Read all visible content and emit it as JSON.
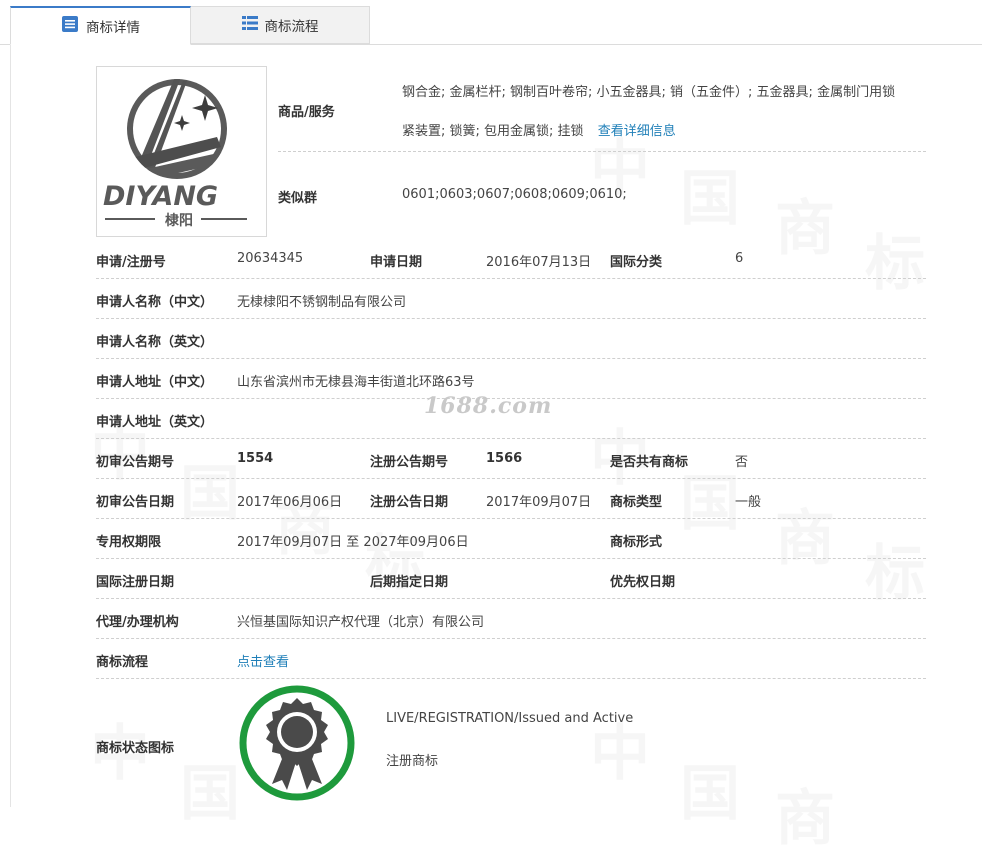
{
  "tabs": {
    "details": "商标详情",
    "flow": "商标流程"
  },
  "logo": {
    "main_text": "DIYANG",
    "sub_text": "棣阳"
  },
  "goods": {
    "label": "商品/服务",
    "line1": "钢合金; 金属栏杆; 钢制百叶卷帘; 小五金器具; 销（五金件）; 五金器具; 金属制门用锁",
    "line2": "紧装置; 锁簧; 包用金属锁; 挂锁",
    "more_link": "查看详细信息"
  },
  "similar_groups": {
    "label": "类似群",
    "value": "0601;0603;0607;0608;0609;0610;"
  },
  "fields": {
    "reg_no_label": "申请/注册号",
    "reg_no": "20634345",
    "app_date_label": "申请日期",
    "app_date": "2016年07月13日",
    "intl_class_label": "国际分类",
    "intl_class": "6",
    "applicant_cn_label": "申请人名称（中文）",
    "applicant_cn": "无棣棣阳不锈钢制品有限公司",
    "applicant_en_label": "申请人名称（英文）",
    "applicant_en": "",
    "address_cn_label": "申请人地址（中文）",
    "address_cn": "山东省滨州市无棣县海丰街道北环路63号",
    "address_en_label": "申请人地址（英文）",
    "address_en": "",
    "prelim_no_label": "初审公告期号",
    "prelim_no": "1554",
    "reg_pub_no_label": "注册公告期号",
    "reg_pub_no": "1566",
    "shared_label": "是否共有商标",
    "shared": "否",
    "prelim_date_label": "初审公告日期",
    "prelim_date": "2017年06月06日",
    "reg_pub_date_label": "注册公告日期",
    "reg_pub_date": "2017年09月07日",
    "tm_type_label": "商标类型",
    "tm_type": "一般",
    "exclusive_label": "专用权期限",
    "exclusive": "2017年09月07日 至 2027年09月06日",
    "tm_form_label": "商标形式",
    "tm_form": "",
    "intl_reg_date_label": "国际注册日期",
    "intl_reg_date": "",
    "later_date_label": "后期指定日期",
    "later_date": "",
    "priority_date_label": "优先权日期",
    "priority_date": "",
    "agent_label": "代理/办理机构",
    "agent": "兴恒基国际知识产权代理（北京）有限公司",
    "flow_label": "商标流程",
    "flow_link": "点击查看"
  },
  "status": {
    "label": "商标状态图标",
    "line1": "LIVE/REGISTRATION/Issued and Active",
    "line2": "注册商标"
  },
  "watermark": {
    "site": "1688.com",
    "chars": [
      "中",
      "国",
      "商",
      "标"
    ]
  },
  "colors": {
    "tab_accent": "#3b7bc8",
    "link": "#1f7fb8",
    "badge_ring": "#1e9a3c",
    "badge_body": "#4a4a4a"
  }
}
